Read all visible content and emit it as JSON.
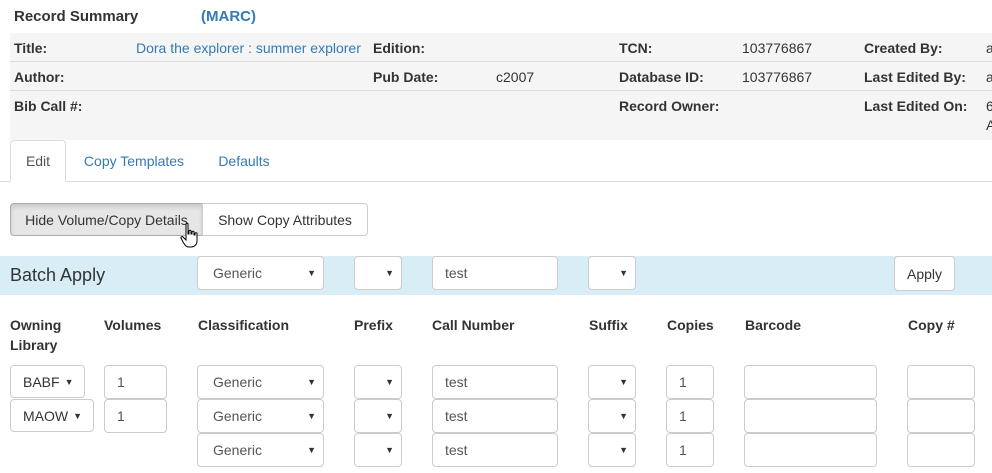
{
  "summary": {
    "title": "Record Summary",
    "marc_link": "(MARC)",
    "title_label": "Title:",
    "title_value": "Dora the explorer : summer explorer",
    "edition_label": "Edition:",
    "edition_value": "",
    "tcn_label": "TCN:",
    "tcn_value": "103776867",
    "created_by_label": "Created By:",
    "created_by_value": "a",
    "author_label": "Author:",
    "author_value": "",
    "pub_date_label": "Pub Date:",
    "pub_date_value": "c2007",
    "database_id_label": "Database ID:",
    "database_id_value": "103776867",
    "last_edited_by_label": "Last Edited By:",
    "last_edited_by_value": "a",
    "bib_call_label": "Bib Call #:",
    "bib_call_value": "",
    "record_owner_label": "Record Owner:",
    "record_owner_value": "",
    "last_edited_on_label": "Last Edited On:",
    "last_edited_on_value_1": "6",
    "last_edited_on_value_2": "A"
  },
  "tabs": [
    {
      "label": "Edit",
      "active": true
    },
    {
      "label": "Copy Templates",
      "active": false
    },
    {
      "label": "Defaults",
      "active": false
    }
  ],
  "toolbar": {
    "hide_label": "Hide Volume/Copy Details",
    "show_label": "Show Copy Attributes"
  },
  "batch": {
    "title": "Batch Apply",
    "classification": "Generic",
    "prefix": "",
    "call_number": "test",
    "suffix": "",
    "apply_label": "Apply"
  },
  "columns": {
    "owning_library_1": "Owning",
    "owning_library_2": "Library",
    "volumes": "Volumes",
    "classification": "Classification",
    "prefix": "Prefix",
    "call_number": "Call Number",
    "suffix": "Suffix",
    "copies": "Copies",
    "barcode": "Barcode",
    "copy_num": "Copy #"
  },
  "rows": [
    {
      "library": "BABF",
      "volumes": "1",
      "classification": "Generic",
      "call_number": "test",
      "copies": "1",
      "barcode": "",
      "copy_num": ""
    },
    {
      "library": "MAOW",
      "volumes": "1",
      "classification": "Generic",
      "call_number": "test",
      "copies": "1",
      "barcode": "",
      "copy_num": ""
    },
    {
      "library": "",
      "volumes": "",
      "classification": "Generic",
      "call_number": "test",
      "copies": "1",
      "barcode": "",
      "copy_num": ""
    }
  ],
  "colors": {
    "link": "#337ab7",
    "batch_bg": "#d9edf7",
    "summary_bg": "#f5f5f5"
  },
  "icons": {
    "caret": "caret-down-icon",
    "cursor": "hand-pointer-icon"
  }
}
